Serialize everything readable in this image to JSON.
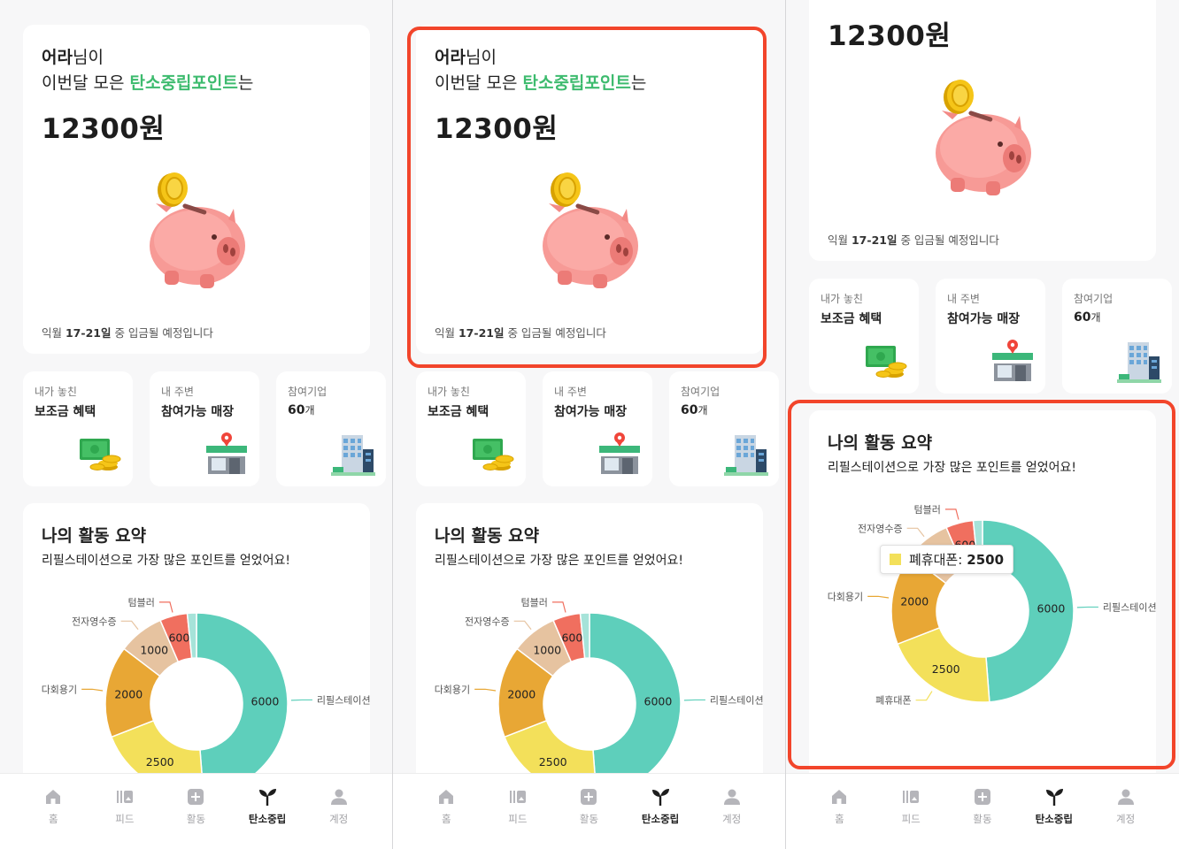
{
  "points_card": {
    "name": "어라",
    "name_suffix": "님이",
    "line_prefix": "이번달 모은 ",
    "line_highlight": "탄소중립포인트",
    "line_suffix": "는",
    "amount": "12300원",
    "note_prefix": "익월 ",
    "note_bold": "17-21일",
    "note_suffix": " 중 입금될 예정입니다"
  },
  "tiles": [
    {
      "small": "내가 놓친",
      "big": "보조금 혜택",
      "icon": "money-icon"
    },
    {
      "small": "내 주변",
      "big": "참여가능 매장",
      "icon": "store-icon"
    },
    {
      "small": "참여기업",
      "big": "60",
      "unit": "개",
      "icon": "building-icon"
    }
  ],
  "summary": {
    "title": "나의 활동 요약",
    "subtitle": "리필스테이션으로 가장 많은 포인트를 얻었어요!"
  },
  "tooltip": {
    "label": "폐휴대폰:",
    "value": "2500"
  },
  "chart_data": {
    "type": "pie",
    "variant": "donut",
    "categories": [
      "리필스테이션",
      "폐휴대폰",
      "다회용기",
      "전자영수증",
      "텀블러",
      ""
    ],
    "values": [
      6000,
      2500,
      2000,
      1000,
      600,
      200
    ],
    "value_labels": [
      "6000",
      "2500",
      "2000",
      "1000",
      "600",
      ""
    ],
    "colors": [
      "#5ecfbb",
      "#f3e05a",
      "#e8a735",
      "#e6c3a0",
      "#f06f5f",
      "#a6e3d9"
    ]
  },
  "tabbar": [
    {
      "label": "홈",
      "icon": "home-icon",
      "active": false
    },
    {
      "label": "피드",
      "icon": "feed-icon",
      "active": false
    },
    {
      "label": "활동",
      "icon": "plus-icon",
      "active": false
    },
    {
      "label": "탄소중립",
      "icon": "sprout-icon",
      "active": true
    },
    {
      "label": "계정",
      "icon": "person-icon",
      "active": false
    }
  ],
  "colors": {
    "accent_green": "#3dbb6e",
    "highlight_red": "#f2452b"
  }
}
